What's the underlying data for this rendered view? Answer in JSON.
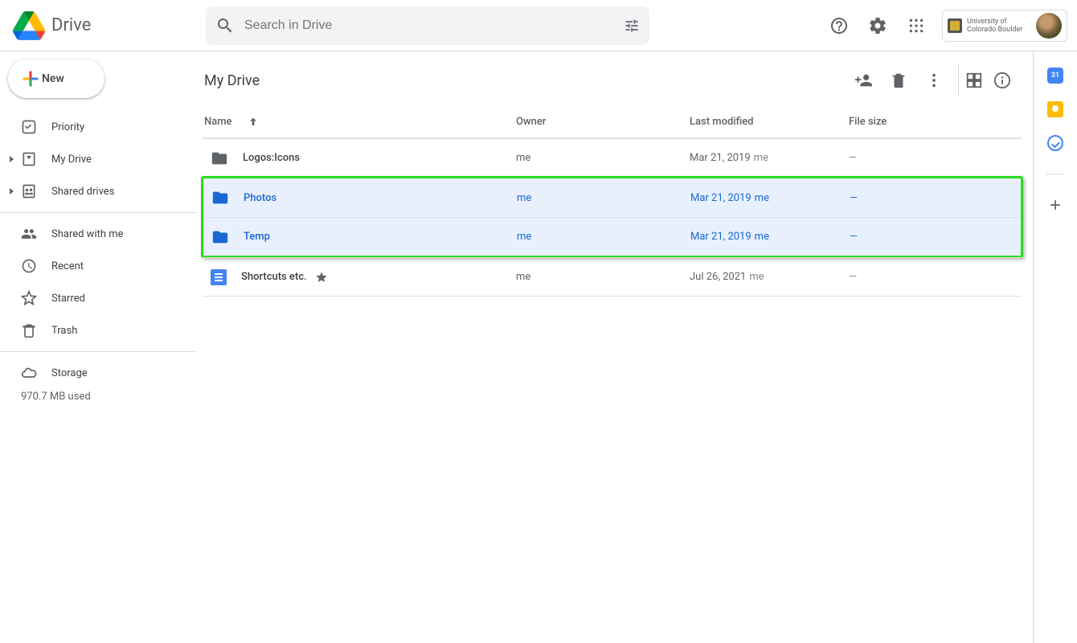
{
  "header": {
    "app_name": "Drive",
    "search_placeholder": "Search in Drive",
    "org_name": "University of Colorado Boulder"
  },
  "sidebar": {
    "new_label": "New",
    "items": [
      {
        "label": "Priority"
      },
      {
        "label": "My Drive"
      },
      {
        "label": "Shared drives"
      },
      {
        "label": "Shared with me"
      },
      {
        "label": "Recent"
      },
      {
        "label": "Starred"
      },
      {
        "label": "Trash"
      },
      {
        "label": "Storage"
      }
    ],
    "storage_used": "970.7 MB used"
  },
  "main": {
    "title": "My Drive",
    "columns": {
      "name": "Name",
      "owner": "Owner",
      "modified": "Last modified",
      "size": "File size"
    },
    "rows": [
      {
        "type": "folder",
        "name": "Logos:Icons",
        "owner": "me",
        "modified": "Mar 21, 2019",
        "modified_by": "me",
        "size": "—",
        "selected": false,
        "starred": false
      },
      {
        "type": "folder",
        "name": "Photos",
        "owner": "me",
        "modified": "Mar 21, 2019",
        "modified_by": "me",
        "size": "—",
        "selected": true,
        "starred": false
      },
      {
        "type": "folder",
        "name": "Temp",
        "owner": "me",
        "modified": "Mar 21, 2019",
        "modified_by": "me",
        "size": "—",
        "selected": true,
        "starred": false
      },
      {
        "type": "doc",
        "name": "Shortcuts etc.",
        "owner": "me",
        "modified": "Jul 26, 2021",
        "modified_by": "me",
        "size": "—",
        "selected": false,
        "starred": true
      }
    ]
  }
}
